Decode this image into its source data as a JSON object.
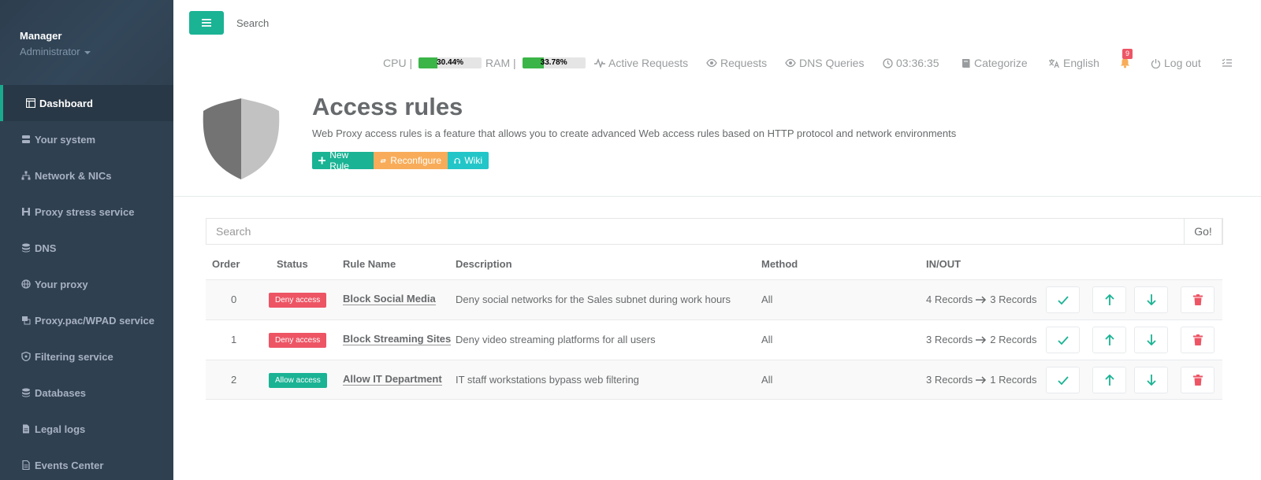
{
  "sidebar": {
    "user_name": "Manager",
    "user_role": "Administrator",
    "items": [
      {
        "label": "Dashboard",
        "icon": "dashboard-icon"
      },
      {
        "label": "Your system",
        "icon": "server-icon"
      },
      {
        "label": "Network & NICs",
        "icon": "network-icon"
      },
      {
        "label": "Proxy stress service",
        "icon": "stress-icon"
      },
      {
        "label": "DNS",
        "icon": "database-icon"
      },
      {
        "label": "Your proxy",
        "icon": "globe-icon"
      },
      {
        "label": "Proxy.pac/WPAD service",
        "icon": "pac-icon"
      },
      {
        "label": "Filtering service",
        "icon": "shield-icon"
      },
      {
        "label": "Databases",
        "icon": "database-icon"
      },
      {
        "label": "Legal logs",
        "icon": "document-icon"
      },
      {
        "label": "Events Center",
        "icon": "file-icon"
      }
    ]
  },
  "topbar": {
    "search_placeholder": "Search",
    "cpu_label": "CPU |",
    "cpu_value": "30.44%",
    "cpu_fraction": 0.3044,
    "ram_label": "RAM |",
    "ram_value": "33.78%",
    "ram_fraction": 0.3378,
    "active_requests": "Active Requests",
    "requests": "Requests",
    "dns_queries": "DNS Queries",
    "clock": "03:36:35",
    "categorize": "Categorize",
    "language": "English",
    "notifications_count": "9",
    "logout": "Log out"
  },
  "header": {
    "title": "Access rules",
    "description": "Web Proxy access rules is a feature that allows you to create advanced Web access rules based on HTTP protocol and network environments",
    "new_rule": "New Rule",
    "reconfigure": "Reconfigure",
    "wiki": "Wiki"
  },
  "table": {
    "search_placeholder": "Search",
    "go_label": "Go!",
    "columns": [
      "Order",
      "Status",
      "Rule Name",
      "Description",
      "Method",
      "IN/OUT"
    ],
    "rows": [
      {
        "order": "0",
        "status": "Deny access",
        "name": "Block Social Media",
        "description": "Deny social networks for the Sales subnet during work hours",
        "method": "All",
        "in": "4 Records",
        "out": "3 Records"
      },
      {
        "order": "1",
        "status": "Deny access",
        "name": "Block Streaming Sites",
        "description": "Deny video streaming platforms for all users",
        "method": "All",
        "in": "3 Records",
        "out": "2 Records"
      },
      {
        "order": "2",
        "status": "Allow access",
        "name": "Allow IT Department",
        "description": "IT staff workstations bypass web filtering",
        "method": "All",
        "in": "3 Records",
        "out": "1 Records"
      }
    ]
  },
  "colors": {
    "primary": "#1ab394",
    "warning": "#f8ac59",
    "info": "#23c6c8",
    "danger": "#ed5565",
    "sidebar": "#2f4050"
  }
}
